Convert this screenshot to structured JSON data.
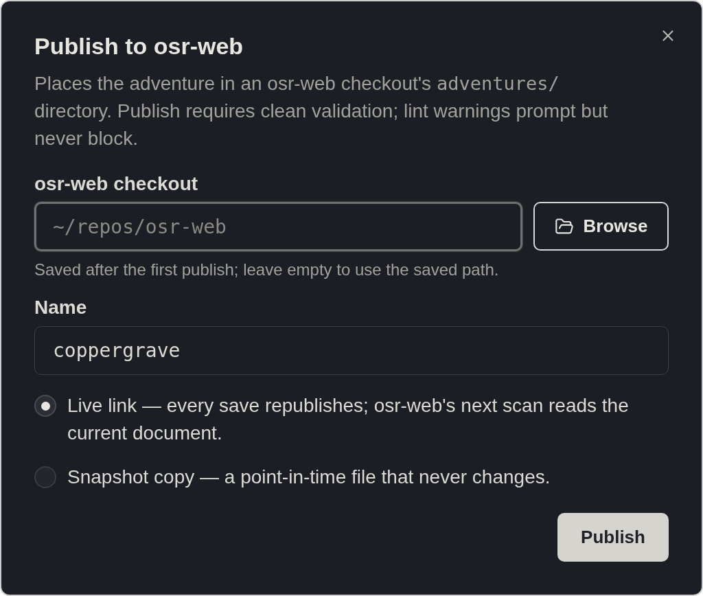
{
  "dialog": {
    "title": "Publish to osr-web",
    "description": [
      {
        "kind": "text",
        "text": "Places the adventure in an osr-web checkout's"
      },
      {
        "kind": "code",
        "text": "adventures/"
      },
      {
        "kind": "text",
        "text": "directory. Publish requires clean validation; lint warnings prompt but never block."
      }
    ],
    "checkout": {
      "label": "osr-web checkout",
      "placeholder": "~/repos/osr-web",
      "focused": true,
      "browse_button": "Browse",
      "hint": "Saved after the first publish; leave empty to use the saved path."
    },
    "name": {
      "label": "Name",
      "value": "coppergrave"
    },
    "publish_mode": [
      {
        "label": "Live link — every save republishes; osr-web's next scan reads the current document.",
        "selected": true
      },
      {
        "label": "Snapshot copy — a point-in-time file that never changes.",
        "selected": false
      }
    ],
    "publish_button": "Publish"
  }
}
